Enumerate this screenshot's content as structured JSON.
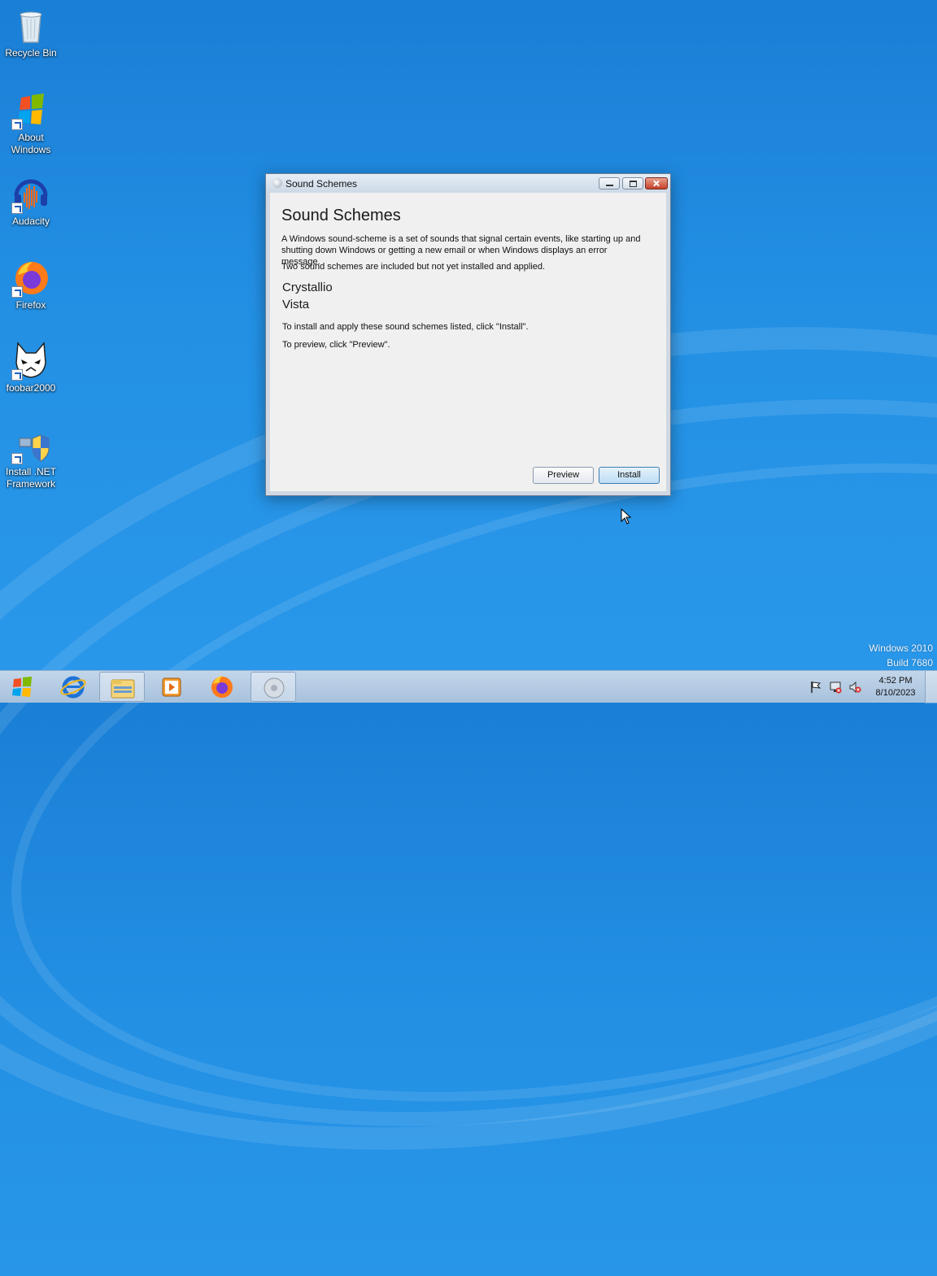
{
  "desktop": {
    "icons": [
      {
        "label": "Recycle Bin"
      },
      {
        "label": "About Windows"
      },
      {
        "label": "Audacity"
      },
      {
        "label": "Firefox"
      },
      {
        "label": "foobar2000"
      },
      {
        "label": "Install .NET Framework"
      }
    ],
    "watermark": {
      "line1": "Windows 2010",
      "line2": "Build 7680"
    }
  },
  "window": {
    "title": "Sound Schemes",
    "heading": "Sound Schemes",
    "description": "A Windows sound-scheme is a set of sounds that signal certain events, like starting up and shutting down Windows or getting a new email or when Windows displays an error message.",
    "included_note": "Two sound schemes are included but not yet installed and applied.",
    "schemes": [
      "Crystallio",
      "Vista"
    ],
    "install_hint": "To install and apply these sound schemes listed, click \"Install\".",
    "preview_hint": "To preview, click \"Preview\".",
    "buttons": {
      "preview": "Preview",
      "install": "Install"
    }
  },
  "taskbar": {
    "pinned": [
      "start-orb",
      "internet-explorer-icon",
      "file-explorer-icon",
      "media-player-icon",
      "firefox-icon",
      "sound-schemes-app-icon"
    ],
    "tray": [
      "flag-icon",
      "network-icon",
      "volume-muted-icon"
    ],
    "clock": {
      "time": "4:52 PM",
      "date": "8/10/2023"
    }
  }
}
